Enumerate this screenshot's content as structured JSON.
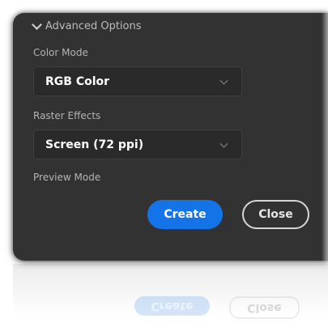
{
  "advanced_options": {
    "header": "Advanced Options",
    "color_mode": {
      "label": "Color Mode",
      "value": "RGB Color"
    },
    "raster_effects": {
      "label": "Raster Effects",
      "value": "Screen (72 ppi)"
    },
    "preview_mode": {
      "label": "Preview Mode"
    }
  },
  "buttons": {
    "create": "Create",
    "close": "Close"
  },
  "colors": {
    "panel_bg": "#323232",
    "accent": "#1473e6",
    "text": "#ffffff",
    "label": "#b4b4b4"
  }
}
